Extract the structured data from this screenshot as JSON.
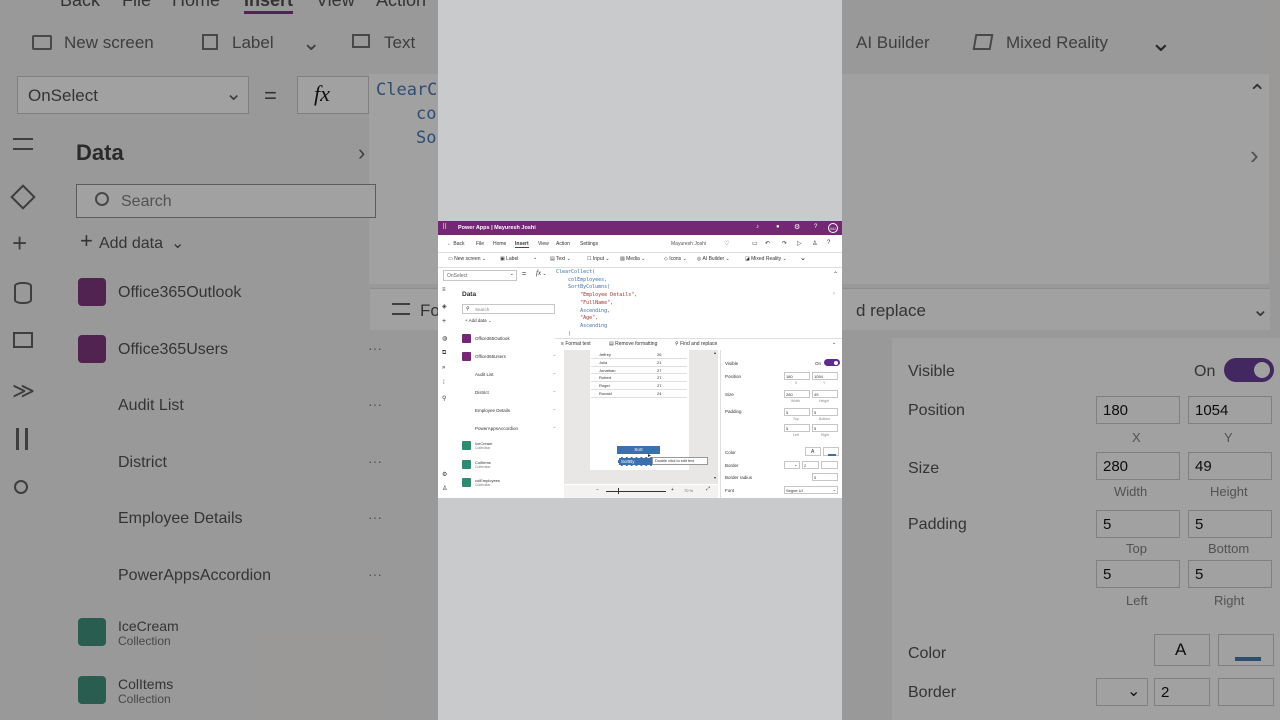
{
  "bg": {
    "menu": {
      "back": "Back",
      "file": "File",
      "home": "Home",
      "insert": "Insert",
      "view": "View",
      "action": "Action"
    },
    "toolbar": {
      "new_screen": "New screen",
      "label": "Label",
      "text": "Text",
      "ai_builder": "AI Builder",
      "mixed_reality": "Mixed Reality"
    },
    "property": "OnSelect",
    "equals": "=",
    "fx": "fx",
    "formula": [
      "ClearC",
      "co",
      "So"
    ],
    "data_title": "Data",
    "search": "Search",
    "add_data": "Add data",
    "sources": [
      "Office365Outlook",
      "Office365Users",
      "Audit List",
      "District",
      "Employee Details",
      "PowerAppsAccordion"
    ],
    "collections": [
      {
        "name": "IceCream",
        "sub": "Collection"
      },
      {
        "name": "ColItems",
        "sub": "Collection"
      }
    ],
    "format_text": "Fo",
    "find_replace": "d replace",
    "props": {
      "visible": "Visible",
      "on": "On",
      "position": "Position",
      "x": "180",
      "y": "1054",
      "x_label": "X",
      "y_label": "Y",
      "size": "Size",
      "w": "280",
      "h": "49",
      "w_label": "Width",
      "h_label": "Height",
      "padding": "Padding",
      "pt": "5",
      "pb": "5",
      "pl": "5",
      "pr": "5",
      "top": "Top",
      "bottom": "Bottom",
      "left": "Left",
      "right": "Right",
      "color": "Color",
      "border": "Border",
      "border_w": "2",
      "color_a": "A"
    }
  },
  "inner": {
    "app_title": "Power Apps  |  Mayuresh Joshi",
    "avatar": "MJ",
    "menu": {
      "back": "Back",
      "file": "File",
      "home": "Home",
      "insert": "Insert",
      "view": "View",
      "action": "Action",
      "settings": "Settings"
    },
    "user": "Mayuresh Joshi",
    "toolbar": {
      "new_screen": "New screen",
      "label": "Label",
      "text": "Text",
      "input": "Input",
      "media": "Media",
      "icons": "Icons",
      "ai_builder": "AI Builder",
      "mixed_reality": "Mixed Reality"
    },
    "property": "OnSelect",
    "equals": "=",
    "fx": "fx",
    "code": [
      "ClearCollect(",
      "    colEmployees,",
      "    SortByColumns(",
      "        \"Employee Details\",",
      "        \"FullName\",",
      "        Ascending,",
      "        \"Age\",",
      "        Ascending",
      "    )"
    ],
    "format_text": "Format text",
    "remove_formatting": "Remove formatting",
    "find_replace": "Find and replace",
    "data_title": "Data",
    "search": "Search",
    "add_data": "Add data",
    "sources": [
      "Office365Outlook",
      "Office365Users",
      "Audit List",
      "District",
      "Employee Details",
      "PowerAppsAccordion"
    ],
    "collections": [
      {
        "name": "IceCream",
        "sub": "Collection"
      },
      {
        "name": "ColItems",
        "sub": "Collection"
      },
      {
        "name": "colEmployees",
        "sub": "Collection"
      }
    ],
    "table": [
      [
        "Jeffrey",
        "26"
      ],
      [
        "Julia",
        "21"
      ],
      [
        "Jonathan",
        "27"
      ],
      [
        "Robert",
        "27"
      ],
      [
        "Roger",
        "27"
      ],
      [
        "Ronald",
        "24"
      ]
    ],
    "sort_button": "Sort",
    "selected_label": "SortBy",
    "tooltip": "Double click to edit text",
    "zoom": "70 %",
    "props": {
      "visible": "Visible",
      "on": "On",
      "position": "Position",
      "x": "180",
      "y": "1054",
      "x_label": "X",
      "y_label": "Y",
      "size": "Size",
      "w": "280",
      "h": "49",
      "w_label": "Width",
      "h_label": "Height",
      "padding": "Padding",
      "pt": "5",
      "pb": "5",
      "pl": "5",
      "pr": "5",
      "top": "Top",
      "bottom": "Bottom",
      "left": "Left",
      "right": "Right",
      "color": "Color",
      "color_a": "A",
      "border": "Border",
      "border_w": "2",
      "border_radius": "Border radius",
      "border_radius_v": "0",
      "font": "Font",
      "font_v": "Segoe UI"
    }
  },
  "colors": {
    "brand": "#742774",
    "accent": "#5c2d91",
    "button": "#3a6fb0"
  }
}
